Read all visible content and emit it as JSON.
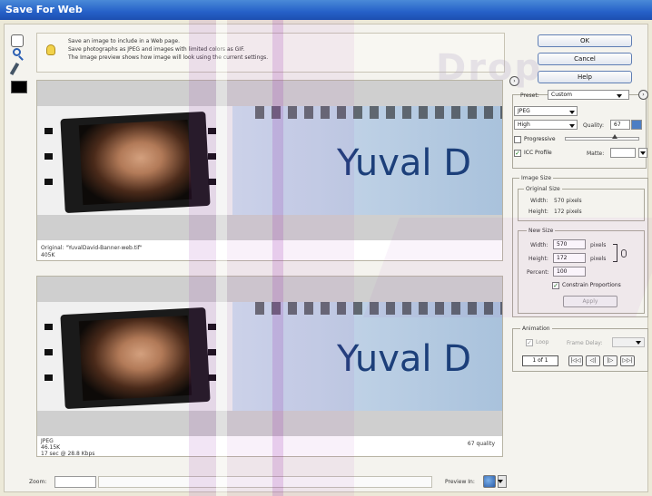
{
  "window": {
    "title": "Save For Web"
  },
  "info": {
    "lines": [
      "Save an image to include in a Web page.",
      "Save photographs as JPEG and images with limited colors as GIF.",
      "The Image preview shows how image will look using the current settings."
    ]
  },
  "previews": {
    "banner_text": "Yuval D",
    "original": {
      "line1": "Original: \"YuvalDavid-Banner-web.tif\"",
      "line2": "405K"
    },
    "optimized": {
      "format": "JPEG",
      "size": "46.15K",
      "time": "17 sec @ 28.8 Kbps",
      "quality": "67 quality"
    }
  },
  "zoom": {
    "label": "Zoom:",
    "value": ""
  },
  "preview_in": {
    "label": "Preview In:"
  },
  "buttons": {
    "ok": "OK",
    "cancel": "Cancel",
    "help": "Help"
  },
  "settings": {
    "preset_label": "Preset:",
    "preset_value": "Custom",
    "format_value": "JPEG",
    "compression_value": "High",
    "quality_label": "Quality:",
    "quality_value": "67",
    "quality_fraction": 0.67,
    "progressive_label": "Progressive",
    "progressive_checked": false,
    "icc_label": "ICC Profile",
    "icc_checked": true,
    "matte_label": "Matte:"
  },
  "image_size": {
    "group_label": "Image Size",
    "original_label": "Original Size",
    "orig_width_label": "Width:",
    "orig_width_value": "570 pixels",
    "orig_height_label": "Height:",
    "orig_height_value": "172 pixels",
    "new_label": "New Size",
    "width_label": "Width:",
    "width_value": "570",
    "height_label": "Height:",
    "height_value": "172",
    "unit": "pixels",
    "percent_label": "Percent:",
    "percent_value": "100",
    "constrain_label": "Constrain Proportions",
    "constrain_checked": true,
    "apply_label": "Apply"
  },
  "animation": {
    "group_label": "Animation",
    "loop_label": "Loop",
    "frame_delay_label": "Frame Delay:",
    "frame_counter": "1 of 1",
    "nav": [
      "|◁◁",
      "◁|",
      "|▷",
      "▷▷|"
    ]
  },
  "colors": {
    "title_bar": "#2560c8",
    "banner_text": "#1c3f7a",
    "button_border": "#5f7eb4"
  }
}
